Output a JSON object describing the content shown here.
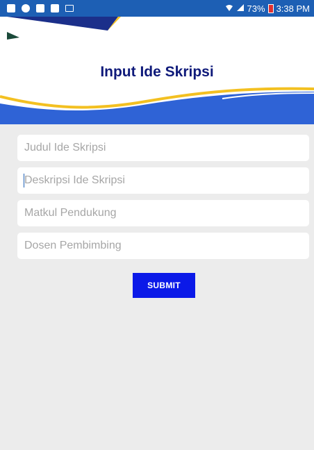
{
  "status_bar": {
    "icons": [
      "image-icon",
      "chat-icon",
      "notification-icon",
      "gallery-icon",
      "mail-icon"
    ],
    "battery": "73%",
    "time": "3:38 PM"
  },
  "header": {
    "title": "Input Ide Skripsi"
  },
  "form": {
    "fields": [
      {
        "placeholder": "Judul Ide Skripsi"
      },
      {
        "placeholder": "Deskripsi Ide Skripsi"
      },
      {
        "placeholder": "Matkul Pendukung"
      },
      {
        "placeholder": "Dosen Pembimbing"
      }
    ],
    "submit_label": "SUBMIT"
  },
  "colors": {
    "status_bar": "#1d5fb4",
    "title": "#0f1a7a",
    "wave_blue": "#2f63d6",
    "wave_yellow": "#f3c021",
    "submit": "#0b19e8",
    "background": "#ececec"
  }
}
